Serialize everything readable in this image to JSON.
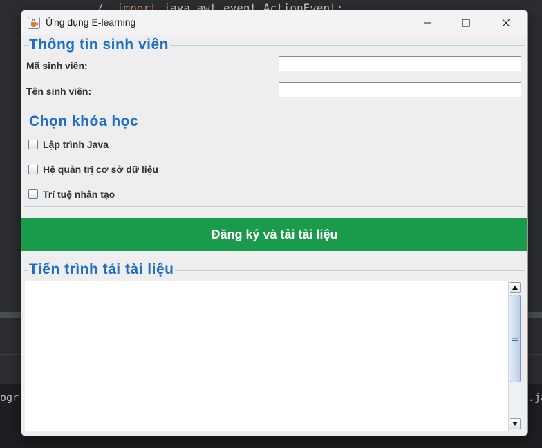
{
  "background": {
    "code_line_prefix": "/  ",
    "code_keyword": "import",
    "code_line_rest": " java.awt.event.ActionEvent;",
    "left_fragment": "ogr",
    "right_fragment": ".ja"
  },
  "window": {
    "title": "Ứng dụng E-learning",
    "app_icon": "java-cup-icon",
    "controls": [
      "minimize-icon",
      "maximize-icon",
      "close-icon"
    ]
  },
  "student_info": {
    "title": "Thông tin sinh viên",
    "id_label": "Mã sinh viên:",
    "id_value": "",
    "name_label": "Tên sinh viên:",
    "name_value": ""
  },
  "courses": {
    "title": "Chọn khóa học",
    "items": [
      {
        "label": "Lập trình Java",
        "checked": false
      },
      {
        "label": "Hệ quản trị cơ sở dữ liệu",
        "checked": false
      },
      {
        "label": "Trí tuệ nhân tạo",
        "checked": false
      }
    ]
  },
  "actions": {
    "register_label": "Đăng ký và tải tài liệu",
    "register_color": "#1a9b4b"
  },
  "progress": {
    "title": "Tiến trình tải tài liệu",
    "log_text": ""
  },
  "colors": {
    "section_title": "#1e6ec5",
    "window_bg": "#eeeeee",
    "border": "#b8cfe5"
  }
}
